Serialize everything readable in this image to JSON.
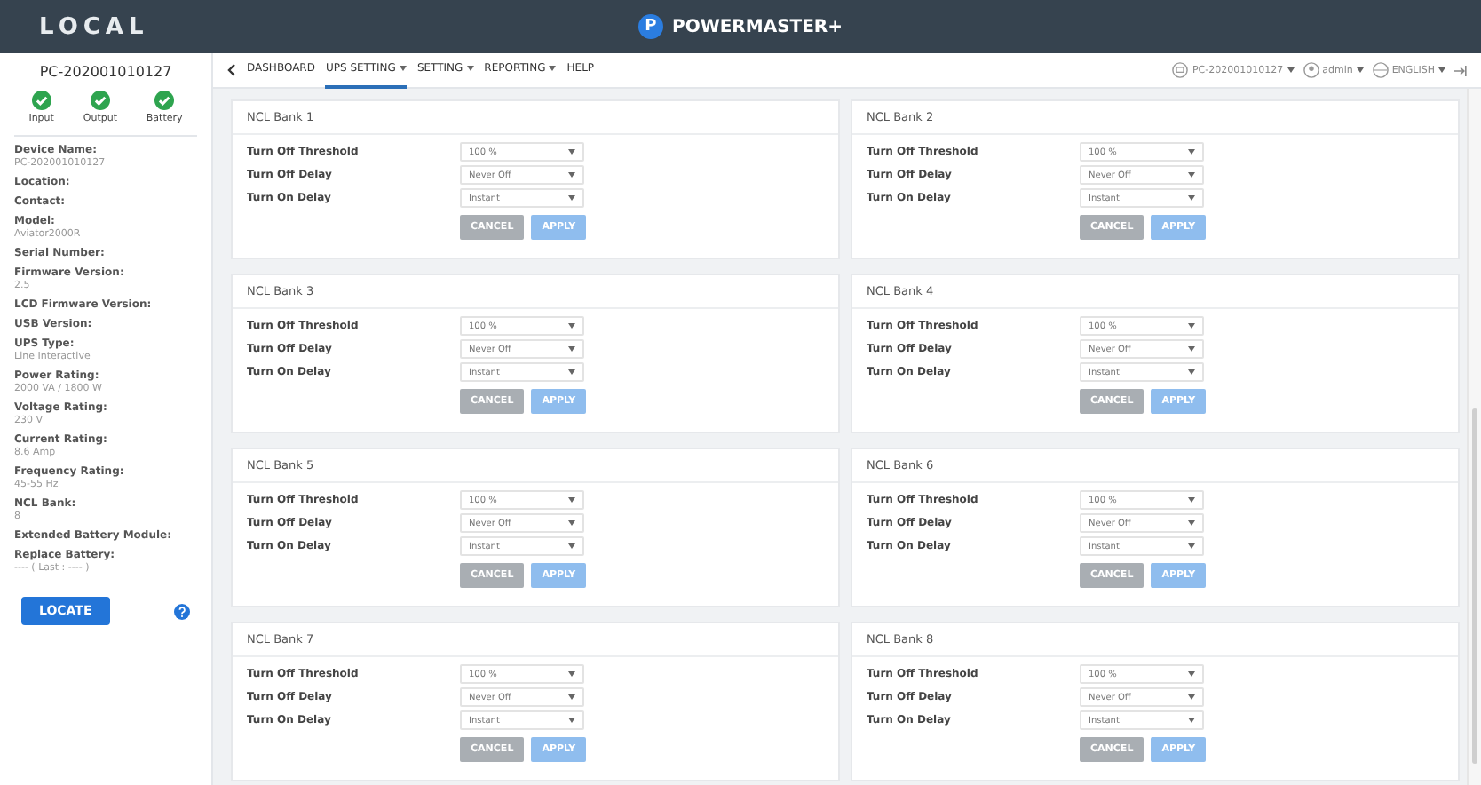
{
  "header": {
    "site": "LOCAL",
    "brand_mark": "P",
    "brand": "POWERMASTER+"
  },
  "sidebar": {
    "device": "PC-202001010127",
    "status": [
      {
        "label": "Input",
        "ok": true
      },
      {
        "label": "Output",
        "ok": true
      },
      {
        "label": "Battery",
        "ok": true
      }
    ],
    "fields": [
      {
        "label": "Device Name:",
        "value": "PC-202001010127"
      },
      {
        "label": "Location:"
      },
      {
        "label": "Contact:"
      },
      {
        "label": "Model:",
        "value": "Aviator2000R"
      },
      {
        "label": "Serial Number:"
      },
      {
        "label": "Firmware Version:",
        "value": "2.5"
      },
      {
        "label": "LCD Firmware Version:"
      },
      {
        "label": "USB Version:"
      },
      {
        "label": "UPS Type:",
        "value": "Line Interactive"
      },
      {
        "label": "Power Rating:",
        "value": "2000 VA / 1800 W"
      },
      {
        "label": "Voltage Rating:",
        "value": "230 V"
      },
      {
        "label": "Current Rating:",
        "value": "8.6 Amp"
      },
      {
        "label": "Frequency Rating:",
        "value": "45-55 Hz"
      },
      {
        "label": "NCL Bank:",
        "value": "8"
      },
      {
        "label": "Extended Battery Module:"
      },
      {
        "label": "Replace Battery:",
        "value": "---- ( Last : ---- )"
      }
    ],
    "locate": "LOCATE"
  },
  "nav": {
    "items": [
      {
        "label": "DASHBOARD",
        "dropdown": false,
        "selected": false
      },
      {
        "label": "UPS SETTING",
        "dropdown": true,
        "selected": true
      },
      {
        "label": "SETTING",
        "dropdown": true,
        "selected": false
      },
      {
        "label": "REPORTING",
        "dropdown": true,
        "selected": false
      },
      {
        "label": "HELP",
        "dropdown": false,
        "selected": false
      }
    ],
    "right": [
      {
        "kind": "device",
        "label": "PC-202001010127"
      },
      {
        "kind": "user",
        "label": "admin"
      },
      {
        "kind": "language",
        "label": "ENGLISH"
      }
    ]
  },
  "banks": [
    {
      "title": "NCL Bank 1",
      "settings": [
        {
          "label": "Turn Off Threshold",
          "value": "100 %"
        },
        {
          "label": "Turn Off Delay",
          "value": "Never Off"
        },
        {
          "label": "Turn On Delay",
          "value": "Instant"
        }
      ],
      "buttons": [
        {
          "label": "CANCEL",
          "kind": "cancel",
          "disabled": true
        },
        {
          "label": "APPLY",
          "kind": "apply",
          "disabled": true
        }
      ]
    },
    {
      "title": "NCL Bank 2",
      "settings": [
        {
          "label": "Turn Off Threshold",
          "value": "100 %"
        },
        {
          "label": "Turn Off Delay",
          "value": "Never Off"
        },
        {
          "label": "Turn On Delay",
          "value": "Instant"
        }
      ],
      "buttons": [
        {
          "label": "CANCEL",
          "kind": "cancel",
          "disabled": true
        },
        {
          "label": "APPLY",
          "kind": "apply",
          "disabled": true
        }
      ]
    },
    {
      "title": "NCL Bank 3",
      "settings": [
        {
          "label": "Turn Off Threshold",
          "value": "100 %"
        },
        {
          "label": "Turn Off Delay",
          "value": "Never Off"
        },
        {
          "label": "Turn On Delay",
          "value": "Instant"
        }
      ],
      "buttons": [
        {
          "label": "CANCEL",
          "kind": "cancel",
          "disabled": true
        },
        {
          "label": "APPLY",
          "kind": "apply",
          "disabled": true
        }
      ]
    },
    {
      "title": "NCL Bank 4",
      "settings": [
        {
          "label": "Turn Off Threshold",
          "value": "100 %"
        },
        {
          "label": "Turn Off Delay",
          "value": "Never Off"
        },
        {
          "label": "Turn On Delay",
          "value": "Instant"
        }
      ],
      "buttons": [
        {
          "label": "CANCEL",
          "kind": "cancel",
          "disabled": true
        },
        {
          "label": "APPLY",
          "kind": "apply",
          "disabled": true
        }
      ]
    },
    {
      "title": "NCL Bank 5",
      "settings": [
        {
          "label": "Turn Off Threshold",
          "value": "100 %"
        },
        {
          "label": "Turn Off Delay",
          "value": "Never Off"
        },
        {
          "label": "Turn On Delay",
          "value": "Instant"
        }
      ],
      "buttons": [
        {
          "label": "CANCEL",
          "kind": "cancel",
          "disabled": true
        },
        {
          "label": "APPLY",
          "kind": "apply",
          "disabled": true
        }
      ]
    },
    {
      "title": "NCL Bank 6",
      "settings": [
        {
          "label": "Turn Off Threshold",
          "value": "100 %"
        },
        {
          "label": "Turn Off Delay",
          "value": "Never Off"
        },
        {
          "label": "Turn On Delay",
          "value": "Instant"
        }
      ],
      "buttons": [
        {
          "label": "CANCEL",
          "kind": "cancel",
          "disabled": true
        },
        {
          "label": "APPLY",
          "kind": "apply",
          "disabled": true
        }
      ]
    },
    {
      "title": "NCL Bank 7",
      "settings": [
        {
          "label": "Turn Off Threshold",
          "value": "100 %"
        },
        {
          "label": "Turn Off Delay",
          "value": "Never Off"
        },
        {
          "label": "Turn On Delay",
          "value": "Instant"
        }
      ],
      "buttons": [
        {
          "label": "CANCEL",
          "kind": "cancel",
          "disabled": true
        },
        {
          "label": "APPLY",
          "kind": "apply",
          "disabled": true
        }
      ]
    },
    {
      "title": "NCL Bank 8",
      "settings": [
        {
          "label": "Turn Off Threshold",
          "value": "100 %"
        },
        {
          "label": "Turn Off Delay",
          "value": "Never Off"
        },
        {
          "label": "Turn On Delay",
          "value": "Instant"
        }
      ],
      "buttons": [
        {
          "label": "CANCEL",
          "kind": "cancel",
          "disabled": true
        },
        {
          "label": "APPLY",
          "kind": "apply",
          "disabled": true
        }
      ]
    }
  ]
}
